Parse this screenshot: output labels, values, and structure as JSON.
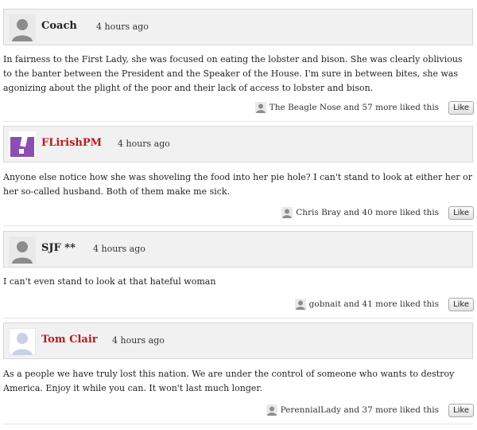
{
  "comments": [
    {
      "author": "Coach",
      "time": "4 hours ago",
      "avatar_icon": "default-silhouette-icon",
      "text": "In fairness to the First Lady, she was focused on eating the lobster and bison.  She was clearly oblivious to the banter between the President and the Speaker of the House.  I'm sure in between bites, she was agonizing about the plight of the poor and their lack of access to lobster and bison.",
      "liked_by": "The Beagle Nose and 57 more liked this",
      "like_label": "Like"
    },
    {
      "author": "FLirishPM",
      "time": "4 hours ago",
      "avatar_icon": "purple-exclamation-avatar-icon",
      "text": "Anyone else notice how she was shoveling the food into her pie hole? I can't stand to look at either her or her so-called husband. Both of them make me sick.",
      "liked_by": "Chris Bray and 40 more liked this",
      "like_label": "Like"
    },
    {
      "author": "SJF **",
      "time": "4 hours ago",
      "avatar_icon": "default-silhouette-icon",
      "text": "I can't even stand to look at that hateful woman",
      "liked_by": "gobnait and 41 more liked this",
      "like_label": "Like"
    },
    {
      "author": "Tom Clair",
      "time": "4 hours ago",
      "avatar_icon": "facebook-default-avatar-icon",
      "text": "As a people we have truly lost this nation. We are under the control of someone who wants to destroy America. Enjoy it while you can. It won't last much longer.",
      "liked_by": "PerennialLady and 37 more liked this",
      "like_label": "Like"
    }
  ],
  "colors": {
    "header_bg": "#f1f1f1",
    "author_link": "#b51c1c",
    "avatar_purple": "#8a4fb0"
  }
}
